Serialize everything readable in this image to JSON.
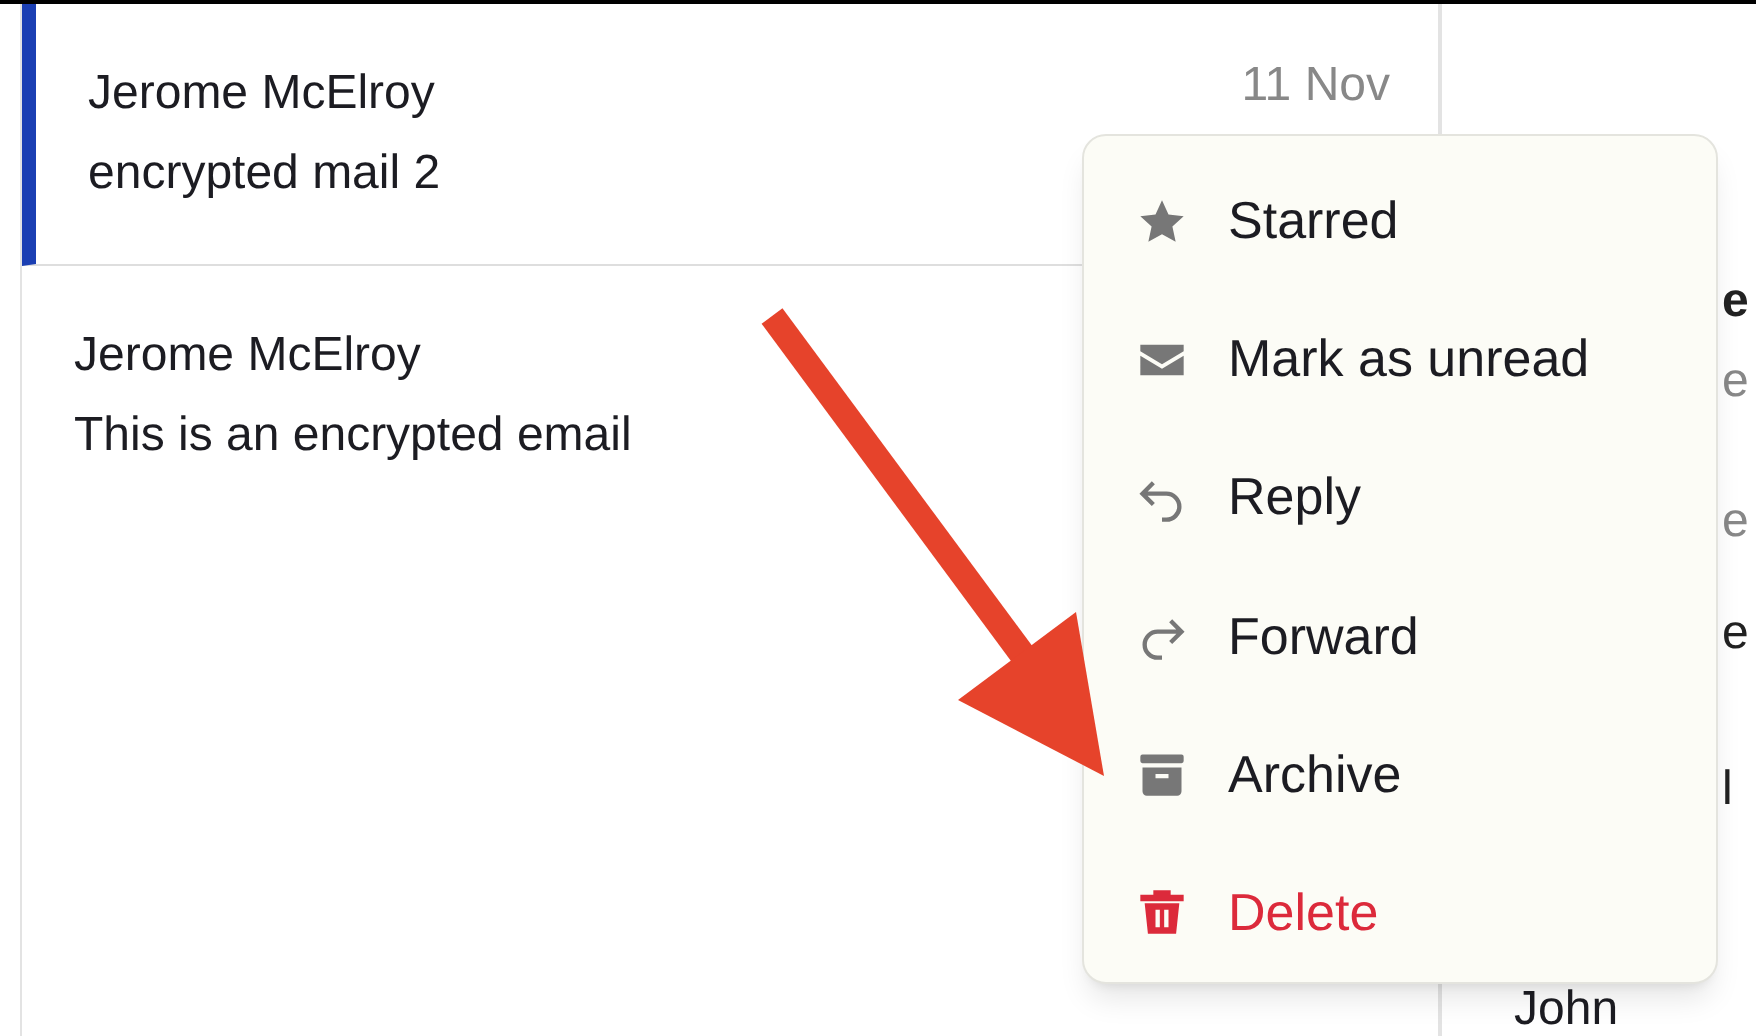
{
  "messages": [
    {
      "sender": "Jerome McElroy",
      "subject": "encrypted mail 2",
      "date": "11 Nov",
      "selected": true
    },
    {
      "sender": "Jerome McElroy",
      "subject": "This is an encrypted email",
      "selected": false
    }
  ],
  "reading_pane": {
    "fragments": [
      "e",
      "e",
      "e",
      "e",
      "l"
    ],
    "signature": "John"
  },
  "context_menu": {
    "items": [
      {
        "label": "Starred",
        "kind": "normal"
      },
      {
        "label": "Mark as unread",
        "kind": "normal"
      },
      {
        "label": "Reply",
        "kind": "normal"
      },
      {
        "label": "Forward",
        "kind": "normal"
      },
      {
        "label": "Archive",
        "kind": "normal"
      },
      {
        "label": "Delete",
        "kind": "danger"
      }
    ]
  }
}
